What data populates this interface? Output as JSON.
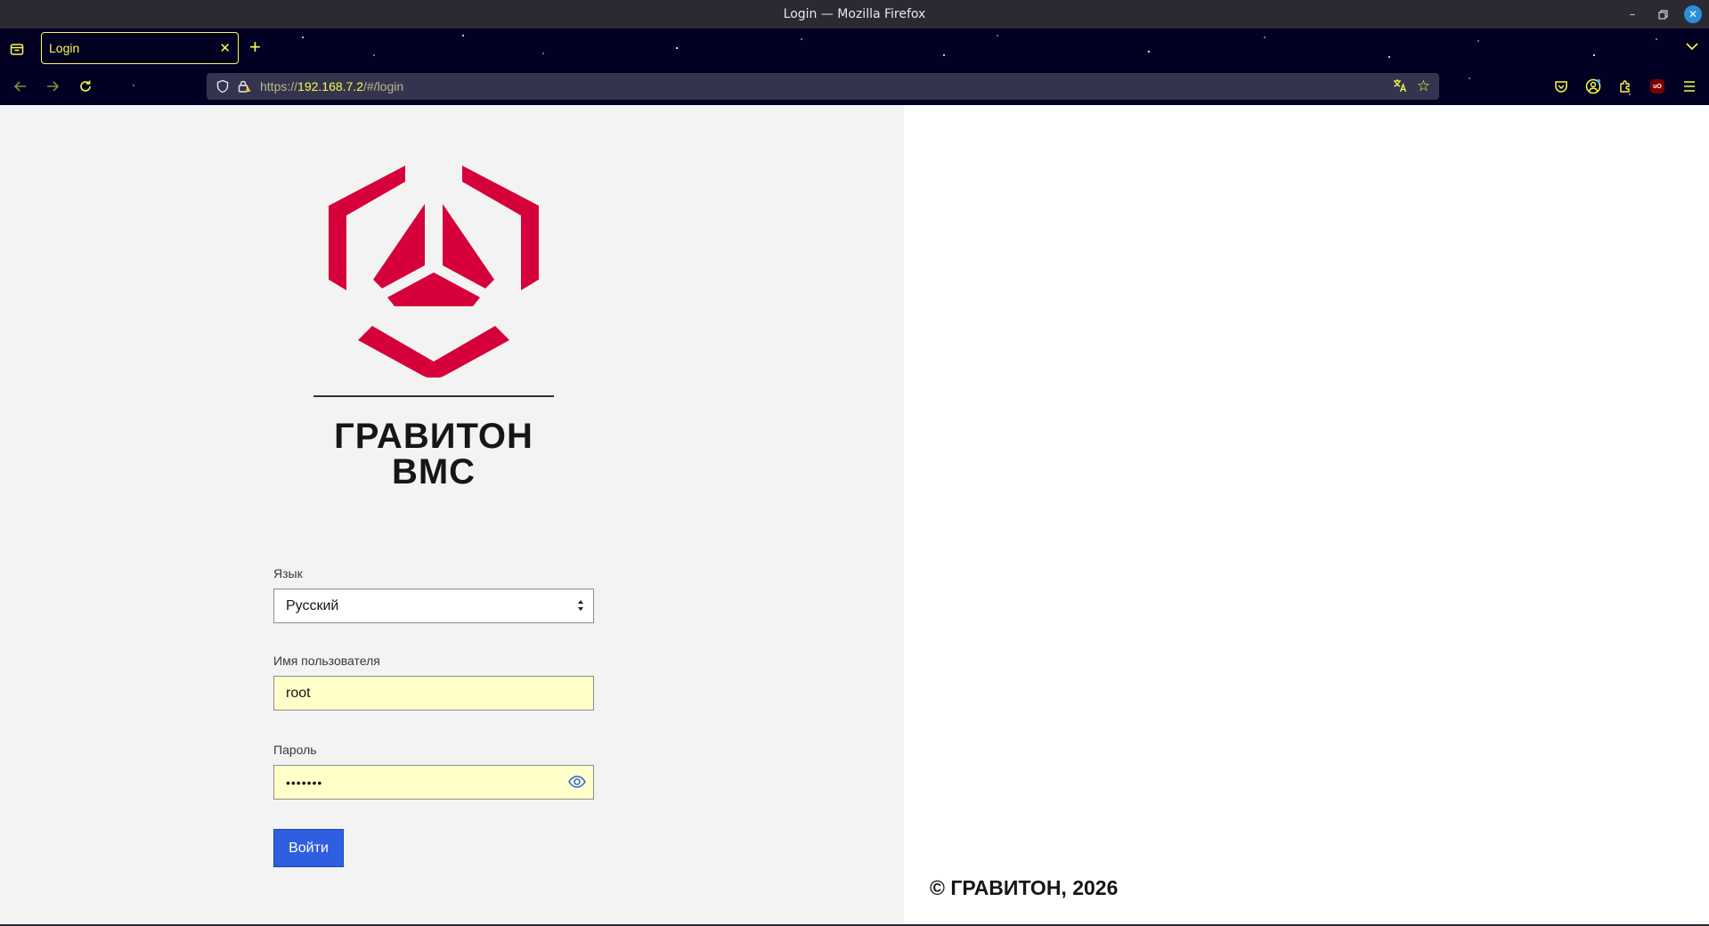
{
  "window": {
    "title": "Login — Mozilla Firefox"
  },
  "tabs": [
    {
      "label": "Login"
    }
  ],
  "address_bar": {
    "scheme": "https://",
    "host": "192.168.7.2",
    "path": "/#/login"
  },
  "icons": {
    "back": "arrow-left-icon",
    "forward": "arrow-right-icon",
    "reload": "reload-icon",
    "shield": "shield-icon",
    "lock": "lock-warning-icon",
    "translate": "translate-icon",
    "bookmark": "star-icon",
    "pocket": "pocket-icon",
    "account": "account-icon",
    "extensions": "puzzle-icon",
    "ublock": "ublock-origin-icon",
    "menu": "hamburger-icon"
  },
  "brand": {
    "line1": "ГРАВИТОН",
    "line2": "BMC",
    "logo_color": "#d6003a"
  },
  "form": {
    "language_label": "Язык",
    "language_value": "Русский",
    "username_label": "Имя пользователя",
    "username_value": "root",
    "password_label": "Пароль",
    "password_masked": "•••••••",
    "submit_label": "Войти"
  },
  "footer": {
    "copyright": "© ГРАВИТОН, 2026"
  },
  "colors": {
    "accent_button": "#2f5fe0",
    "autofill_bg": "#ffffc9",
    "chrome_accent": "#fbfb48"
  }
}
